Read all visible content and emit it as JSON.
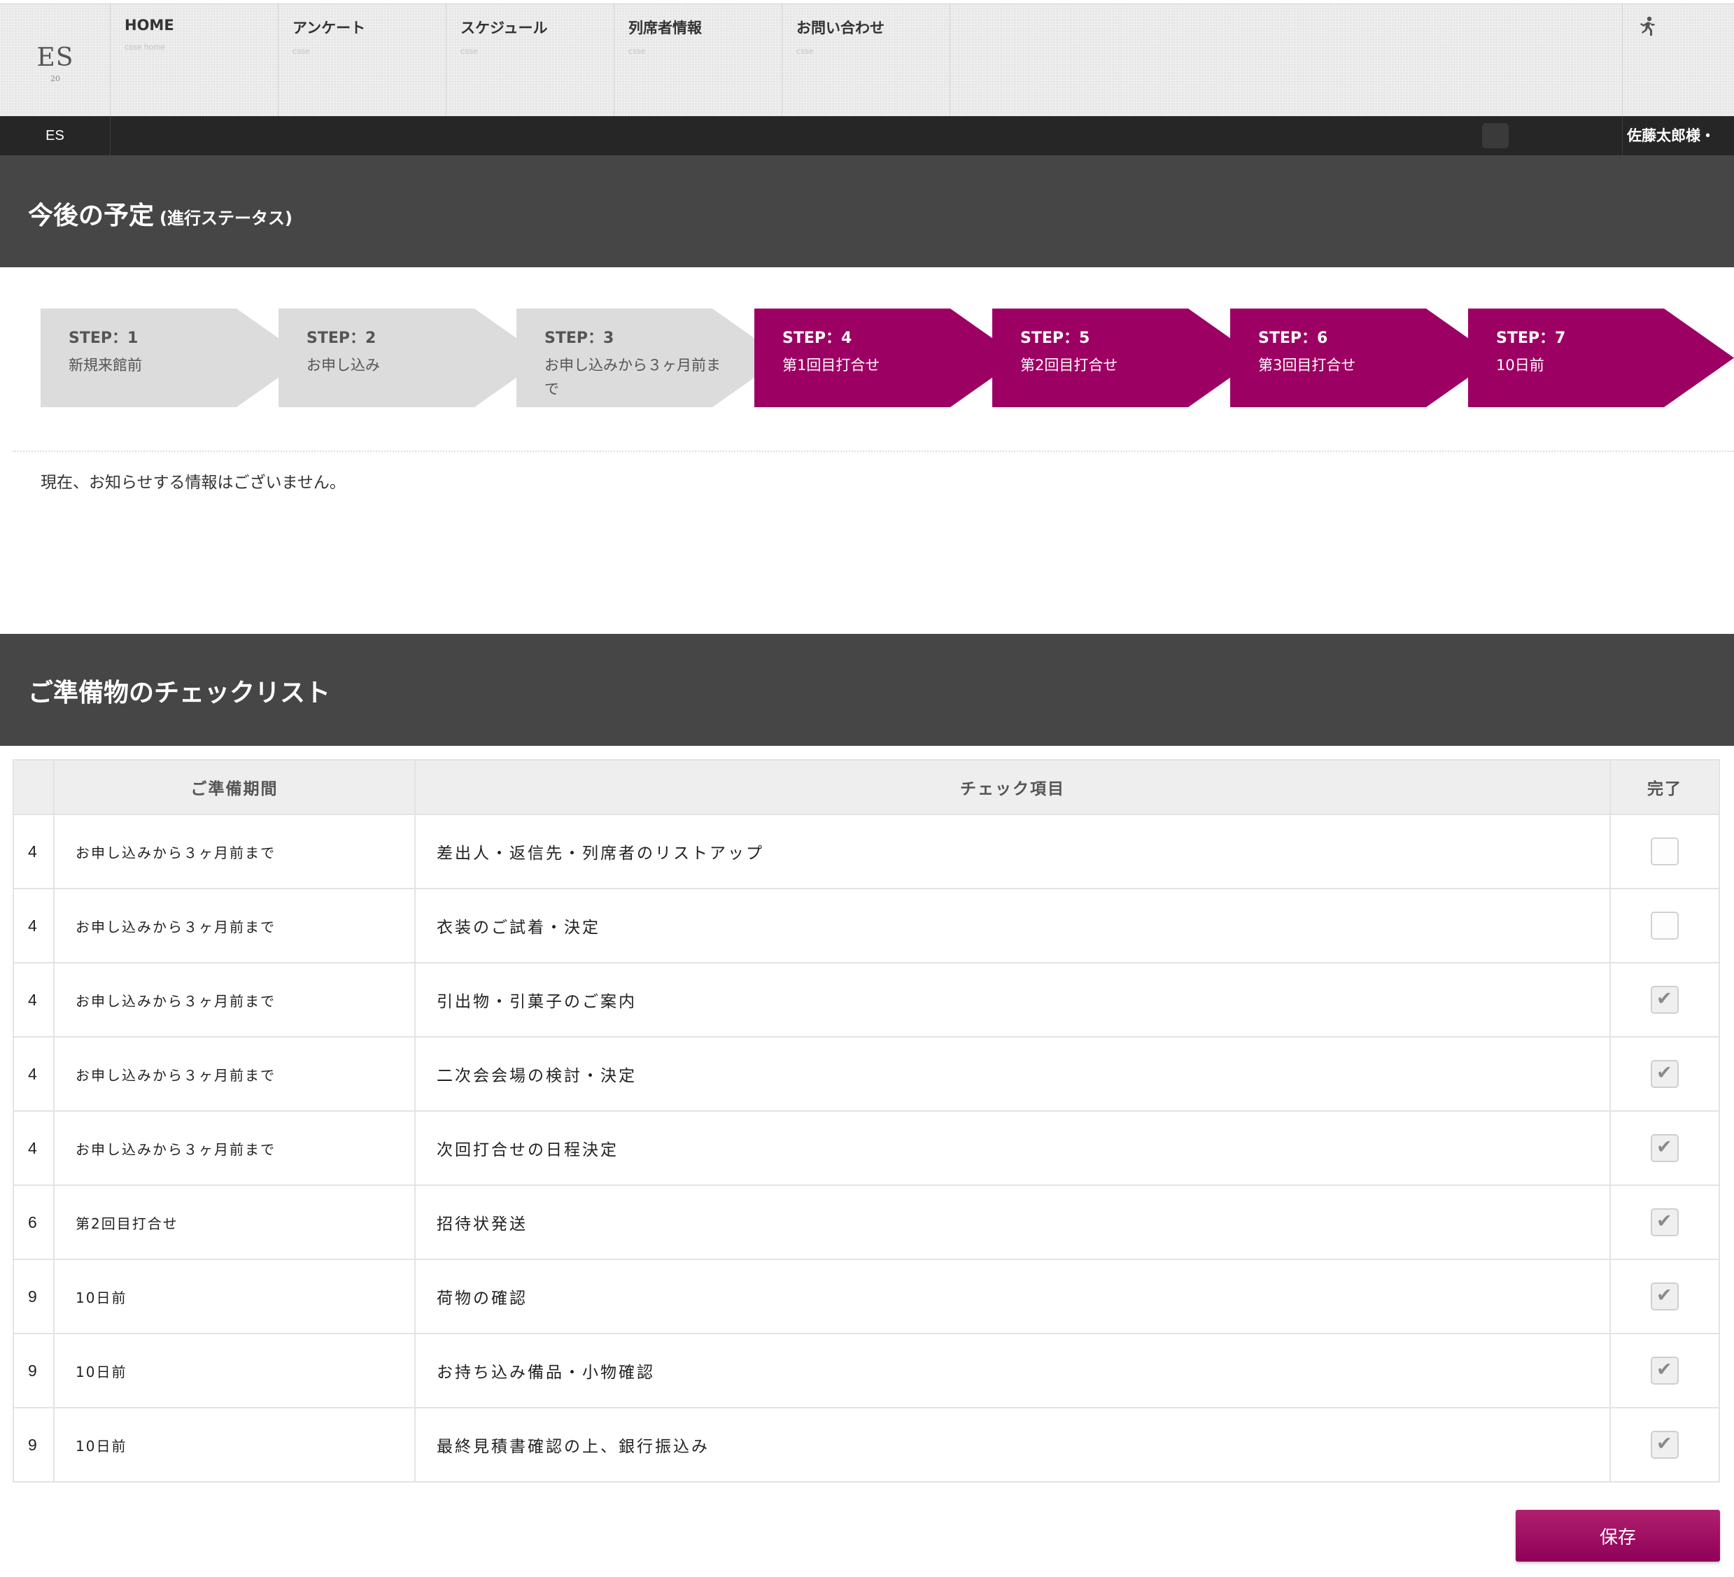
{
  "logo": {
    "text": "ES",
    "sub": "20"
  },
  "nav": [
    {
      "label": "HOME",
      "sub": "csse home"
    },
    {
      "label": "アンケート",
      "sub": "csse"
    },
    {
      "label": "スケジュール",
      "sub": "csse"
    },
    {
      "label": "列席者情報",
      "sub": "csse"
    },
    {
      "label": "お問い合わせ",
      "sub": "csse"
    }
  ],
  "subbar": {
    "brand": "ES",
    "user": "佐藤太郎様・"
  },
  "schedule": {
    "title": "今後の予定",
    "subtitle": "(進行ステータス)",
    "steps": [
      {
        "no": "STEP：1",
        "name": "新規来館前",
        "active": false
      },
      {
        "no": "STEP：2",
        "name": "お申し込み",
        "active": false
      },
      {
        "no": "STEP：3",
        "name": "お申し込みから３ヶ月前まで",
        "active": false
      },
      {
        "no": "STEP：4",
        "name": "第1回目打合せ",
        "active": true
      },
      {
        "no": "STEP：5",
        "name": "第2回目打合せ",
        "active": true
      },
      {
        "no": "STEP：6",
        "name": "第3回目打合せ",
        "active": true
      },
      {
        "no": "STEP：7",
        "name": "10日前",
        "active": true
      }
    ],
    "notice": "現在、お知らせする情報はございません。"
  },
  "checklist": {
    "title": "ご準備物のチェックリスト",
    "headers": {
      "num": "",
      "period": "ご準備期間",
      "item": "チェック項目",
      "done": "完了"
    },
    "rows": [
      {
        "num": "4",
        "period": "お申し込みから３ヶ月前まで",
        "item": "差出人・返信先・列席者のリストアップ",
        "done": false
      },
      {
        "num": "4",
        "period": "お申し込みから３ヶ月前まで",
        "item": "衣装のご試着・決定",
        "done": false
      },
      {
        "num": "4",
        "period": "お申し込みから３ヶ月前まで",
        "item": "引出物・引菓子のご案内",
        "done": true
      },
      {
        "num": "4",
        "period": "お申し込みから３ヶ月前まで",
        "item": "二次会会場の検討・決定",
        "done": true
      },
      {
        "num": "4",
        "period": "お申し込みから３ヶ月前まで",
        "item": "次回打合せの日程決定",
        "done": true
      },
      {
        "num": "6",
        "period": "第2回目打合せ",
        "item": "招待状発送",
        "done": true
      },
      {
        "num": "9",
        "period": "10日前",
        "item": "荷物の確認",
        "done": true
      },
      {
        "num": "9",
        "period": "10日前",
        "item": "お持ち込み備品・小物確認",
        "done": true
      },
      {
        "num": "9",
        "period": "10日前",
        "item": "最終見積書確認の上、銀行振込み",
        "done": true
      }
    ]
  },
  "save_label": "保存",
  "colors": {
    "accent": "#9c0063",
    "header_bg": "#464646",
    "subbar_bg": "#262626",
    "step_inactive": "#dcdcdc"
  },
  "icons": {
    "top_right": "running-person-icon"
  }
}
